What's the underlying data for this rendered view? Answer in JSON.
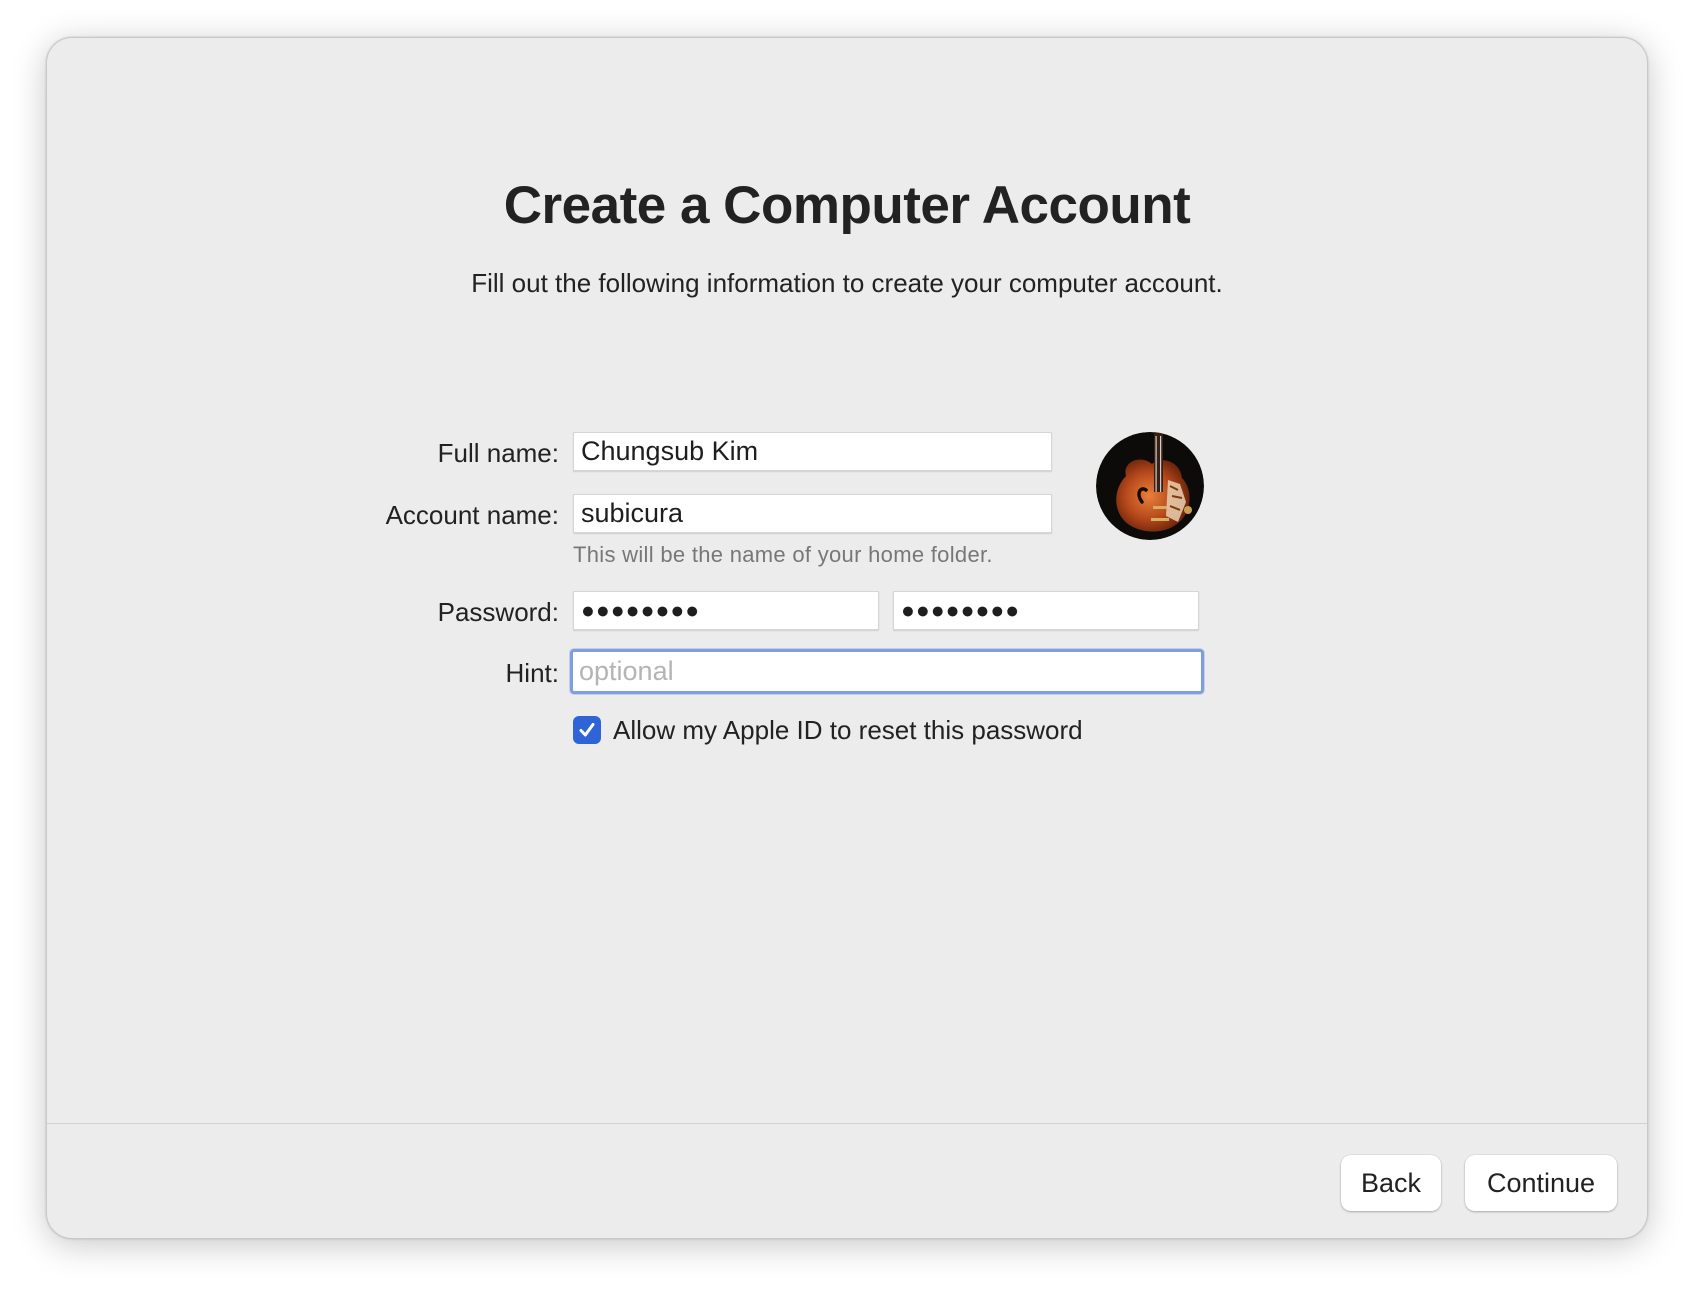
{
  "header": {
    "title": "Create a Computer Account",
    "subtitle": "Fill out the following information to create your computer account."
  },
  "form": {
    "full_name": {
      "label": "Full name:",
      "value": "Chungsub Kim"
    },
    "account_name": {
      "label": "Account name:",
      "value": "subicura",
      "helper": "This will be the name of your home folder."
    },
    "password": {
      "label": "Password:",
      "value": "●●●●●●●●",
      "verify_value": "●●●●●●●●"
    },
    "hint": {
      "label": "Hint:",
      "value": "",
      "placeholder": "optional"
    },
    "apple_id_reset": {
      "label": "Allow my Apple ID to reset this password",
      "checked": true
    }
  },
  "avatar": {
    "icon": "guitar-avatar-icon"
  },
  "footer": {
    "back_label": "Back",
    "continue_label": "Continue"
  },
  "colors": {
    "window_background": "#ececec",
    "accent": "#2f64d8",
    "focus_ring": "#7d9ee0"
  }
}
